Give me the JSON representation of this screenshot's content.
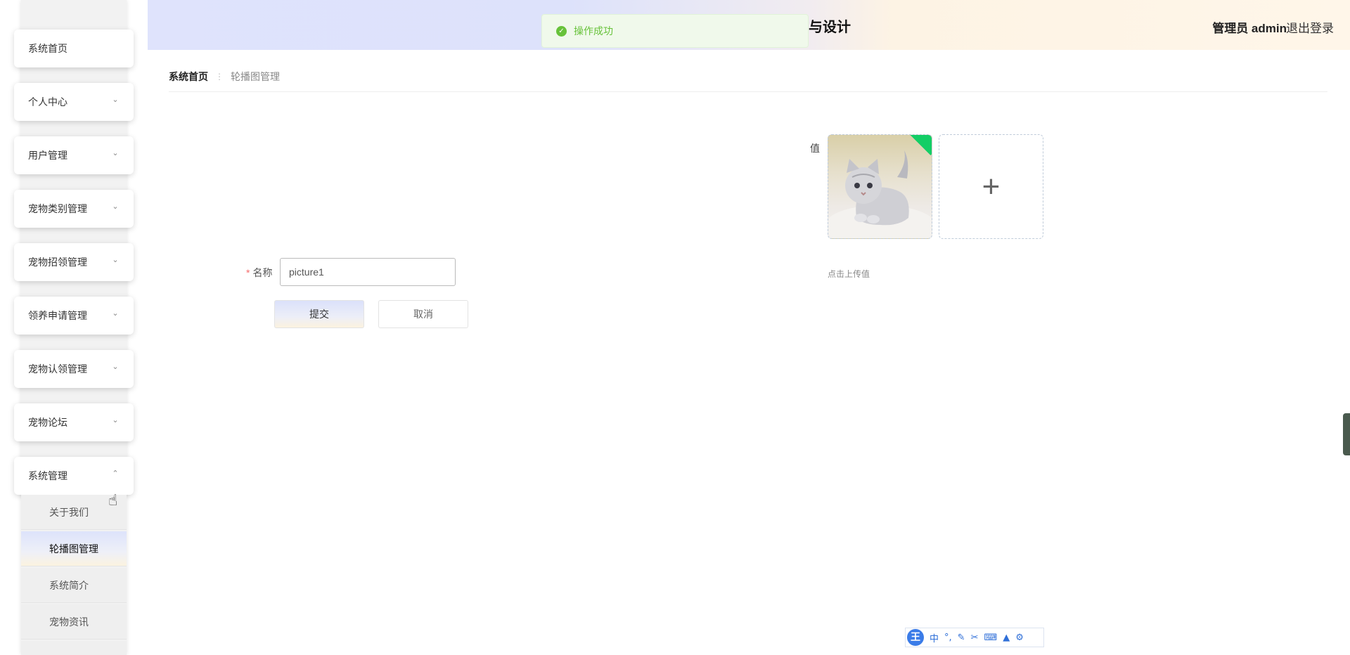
{
  "header": {
    "title": "与设计",
    "user": "管理员 admin",
    "logout": "退出登录"
  },
  "toast": {
    "message": "操作成功",
    "icon": "check-circle-icon"
  },
  "sidebar": {
    "items": [
      {
        "label": "系统首页",
        "expandable": false
      },
      {
        "label": "个人中心",
        "expandable": true
      },
      {
        "label": "用户管理",
        "expandable": true
      },
      {
        "label": "宠物类别管理",
        "expandable": true
      },
      {
        "label": "宠物招领管理",
        "expandable": true
      },
      {
        "label": "领养申请管理",
        "expandable": true
      },
      {
        "label": "宠物认领管理",
        "expandable": true
      },
      {
        "label": "宠物论坛",
        "expandable": true
      },
      {
        "label": "系统管理",
        "expandable": true,
        "expanded": true
      }
    ],
    "submenu": [
      {
        "label": "关于我们"
      },
      {
        "label": "轮播图管理",
        "active": true
      },
      {
        "label": "系统简介"
      },
      {
        "label": "宠物资讯"
      }
    ]
  },
  "breadcrumb": {
    "home": "系统首页",
    "current": "轮播图管理"
  },
  "form": {
    "value_label": "值",
    "upload_hint": "点击上传值",
    "name_label": "名称",
    "name_value": "picture1",
    "submit_label": "提交",
    "cancel_label": "取消"
  },
  "ime_toolbar": {
    "logo": "王",
    "mode": "中"
  },
  "colors": {
    "success": "#67c23a",
    "success_bg": "#f0f9eb",
    "upload_badge": "#13ce66",
    "header_left": "#dfe3fc",
    "header_right": "#fff6e9"
  }
}
